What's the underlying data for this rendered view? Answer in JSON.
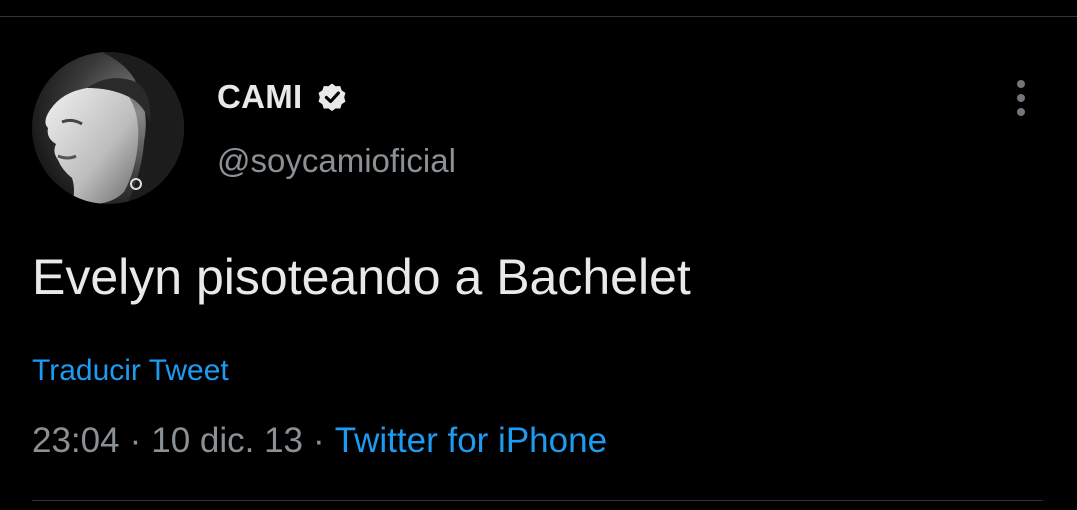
{
  "tweet": {
    "author": {
      "display_name": "CAMI",
      "handle": "@soycamioficial",
      "verified": true,
      "verified_icon": "verified-badge-icon"
    },
    "text": "Evelyn pisoteando a Bachelet",
    "translate_label": "Traducir Tweet",
    "time": "23:04",
    "date": "10 dic. 13",
    "separator": "·",
    "source": "Twitter for iPhone",
    "more_icon": "more-vertical-icon"
  },
  "colors": {
    "background": "#000000",
    "text": "#e7e9ea",
    "secondary_text": "#8b9095",
    "link": "#1d9bf0",
    "divider": "#2f3336"
  }
}
